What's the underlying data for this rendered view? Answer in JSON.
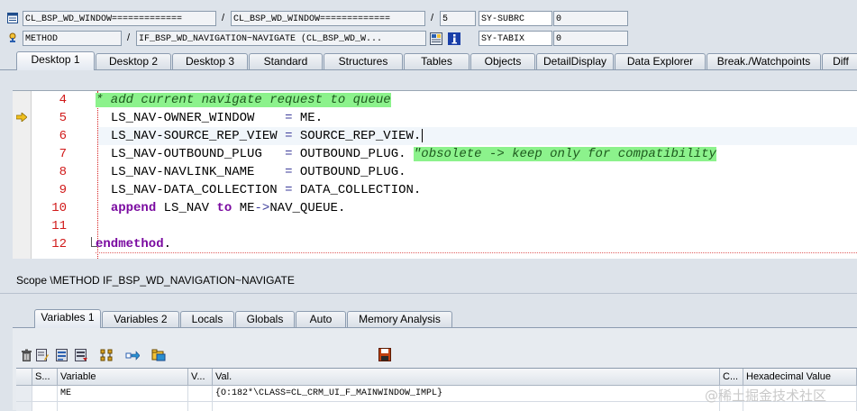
{
  "header": {
    "row1": {
      "class_field": "CL_BSP_WD_WINDOW=============",
      "class_field2": "CL_BSP_WD_WINDOW=============",
      "separator1": "/",
      "separator2": "/",
      "line_field": "5",
      "sysvar_name": "SY-SUBRC",
      "sysvar_value": "0"
    },
    "row2": {
      "type_field": "METHOD",
      "separator": "/",
      "method_field": "IF_BSP_WD_NAVIGATION~NAVIGATE (CL_BSP_WD_W...",
      "sysvar_name": "SY-TABIX",
      "sysvar_value": "0"
    }
  },
  "desktop_tabs": [
    {
      "label": "Desktop 1",
      "active": true
    },
    {
      "label": "Desktop 2",
      "active": false
    },
    {
      "label": "Desktop 3",
      "active": false
    },
    {
      "label": "Standard",
      "active": false
    },
    {
      "label": "Structures",
      "active": false
    },
    {
      "label": "Tables",
      "active": false
    },
    {
      "label": "Objects",
      "active": false
    },
    {
      "label": "DetailDisplay",
      "active": false
    },
    {
      "label": "Data Explorer",
      "active": false
    },
    {
      "label": "Break./Watchpoints",
      "active": false
    },
    {
      "label": "Diff",
      "active": false
    }
  ],
  "editor": {
    "current_line": 5,
    "lines": [
      {
        "num": "4",
        "text": "* add current navigate request to queue"
      },
      {
        "num": "5",
        "field": "LS_NAV-OWNER_WINDOW",
        "pad": "    ",
        "eq": "=",
        "value": "ME",
        "dot": "."
      },
      {
        "num": "6",
        "field": "LS_NAV-SOURCE_REP_VIEW",
        "pad": " ",
        "eq": "=",
        "value": "SOURCE_REP_VIEW",
        "dot": "."
      },
      {
        "num": "7",
        "field": "LS_NAV-OUTBOUND_PLUG",
        "pad": "   ",
        "eq": "=",
        "value": "OUTBOUND_PLUG",
        "dot": ".",
        "comment": "\"obsolete -> keep only for compatibility"
      },
      {
        "num": "8",
        "field": "LS_NAV-NAVLINK_NAME",
        "pad": "    ",
        "eq": "=",
        "value": "OUTBOUND_PLUG",
        "dot": "."
      },
      {
        "num": "9",
        "field": "LS_NAV-DATA_COLLECTION",
        "pad": " ",
        "eq": "=",
        "value": "DATA_COLLECTION",
        "dot": "."
      },
      {
        "num": "10",
        "kw1": "append",
        "obj": "LS_NAV",
        "kw2": "to",
        "target": "ME",
        "arrow": "->",
        "attr": "NAV_QUEUE",
        "dot": "."
      },
      {
        "num": "11"
      },
      {
        "num": "12",
        "kw": "endmethod",
        "dot": "."
      }
    ]
  },
  "scope": "Scope \\METHOD IF_BSP_WD_NAVIGATION~NAVIGATE",
  "variable_tabs": [
    {
      "label": "Variables 1",
      "active": true
    },
    {
      "label": "Variables 2",
      "active": false
    },
    {
      "label": "Locals",
      "active": false
    },
    {
      "label": "Globals",
      "active": false
    },
    {
      "label": "Auto",
      "active": false
    },
    {
      "label": "Memory Analysis",
      "active": false
    }
  ],
  "var_table": {
    "columns": [
      "S...",
      "Variable",
      "V...",
      "Val.",
      "C...",
      "Hexadecimal Value"
    ],
    "rows": [
      {
        "variable": "ME",
        "value": "{O:182*\\CLASS=CL_CRM_UI_F_MAINWINDOW_IMPL}"
      }
    ]
  },
  "watermark": "@稀土掘金技术社区",
  "colors": {
    "comment_bg": "#8cf28c",
    "line_number": "#d11a1a",
    "keyword": "#7a0aa0",
    "background": "#dde3ea"
  },
  "icons": [
    "window-icon",
    "method-icon",
    "source-display-icon",
    "info-icon",
    "current-line-arrow-icon",
    "delete-icon",
    "edit-icon",
    "save-icon",
    "copy-icon",
    "tree-icon",
    "navigate-icon",
    "folder-icon",
    "disk-icon"
  ]
}
